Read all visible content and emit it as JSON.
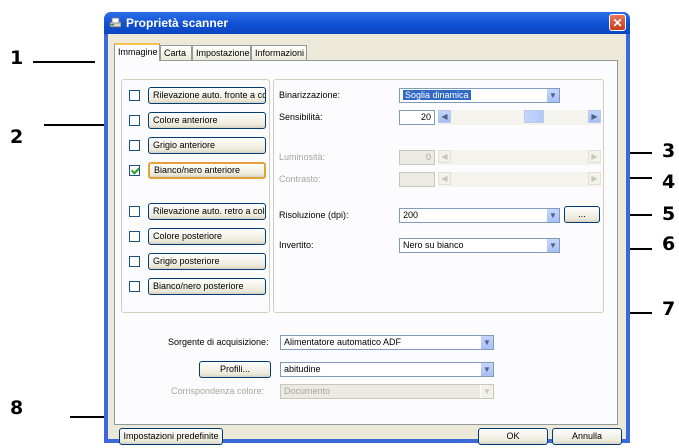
{
  "window": {
    "title": "Proprietà scanner",
    "close_glyph": "✕"
  },
  "tabs": [
    {
      "label": "Immagine",
      "active": true
    },
    {
      "label": "Carta"
    },
    {
      "label": "Impostazione"
    },
    {
      "label": "Informazioni"
    }
  ],
  "image_types": [
    {
      "label": "Rilevazione auto. fronte a colo",
      "checked": false
    },
    {
      "label": "Colore anteriore",
      "checked": false
    },
    {
      "label": "Grigio anteriore",
      "checked": false
    },
    {
      "label": "Bianco/nero anteriore",
      "checked": true
    },
    {
      "label": "Rilevazione auto. retro a color",
      "checked": false
    },
    {
      "label": "Colore posteriore",
      "checked": false
    },
    {
      "label": "Grigio posteriore",
      "checked": false
    },
    {
      "label": "Bianco/nero posteriore",
      "checked": false
    }
  ],
  "settings": {
    "binarization": {
      "label": "Binarizzazione:",
      "value": "Soglia dinamica"
    },
    "sensitivity": {
      "label": "Sensibilità:",
      "value": "20"
    },
    "brightness": {
      "label": "Luminosità:",
      "value": "0"
    },
    "contrast": {
      "label": "Contrasto:"
    },
    "resolution": {
      "label": "Risoluzione (dpi):",
      "value": "200",
      "more_button": "..."
    },
    "invert": {
      "label": "Invertito:",
      "value": "Nero su bianco"
    }
  },
  "source": {
    "label": "Sorgente di acquisizione:",
    "value": "Alimentatore automatico ADF"
  },
  "profiles": {
    "button": "Profili...",
    "value": "abitudine"
  },
  "color_matching": {
    "label": "Corrispondenza colore:",
    "value": "Documento"
  },
  "buttons": {
    "defaults": "Impostazioni predefinite",
    "ok": "OK",
    "cancel": "Annulla"
  },
  "callouts": [
    "1",
    "2",
    "3",
    "4",
    "5",
    "6",
    "7",
    "8"
  ],
  "colors": {
    "title_bar": "#0c4fd0",
    "selection": "#316ac5",
    "focus": "#e5a13a",
    "checkmark": "#21a121"
  }
}
